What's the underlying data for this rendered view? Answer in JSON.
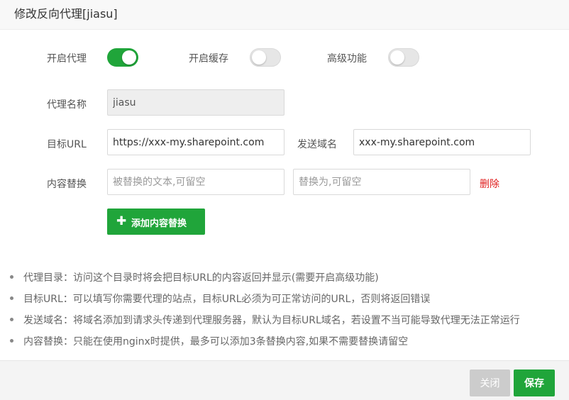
{
  "dialog": {
    "title": "修改反向代理[jiasu]"
  },
  "toggles": [
    {
      "label": "开启代理",
      "state": "on"
    },
    {
      "label": "开启缓存",
      "state": "off"
    },
    {
      "label": "高级功能",
      "state": "off"
    }
  ],
  "form": {
    "proxy_name": {
      "label": "代理名称",
      "value": "jiasu"
    },
    "target_url": {
      "label": "目标URL",
      "value": "https://xxx-my.sharepoint.com"
    },
    "send_domain": {
      "label": "发送域名",
      "value": "xxx-my.sharepoint.com"
    },
    "content_replace": {
      "label": "内容替换",
      "source_placeholder": "被替换的文本,可留空",
      "target_placeholder": "替换为,可留空",
      "delete_label": "删除"
    },
    "add_button": {
      "icon": "plus-icon",
      "label": "添加内容替换"
    }
  },
  "tips": [
    "代理目录：访问这个目录时将会把目标URL的内容返回并显示(需要开启高级功能)",
    "目标URL：可以填写你需要代理的站点，目标URL必须为可正常访问的URL，否则将返回错误",
    "发送域名：将域名添加到请求头传递到代理服务器，默认为目标URL域名，若设置不当可能导致代理无法正常运行",
    "内容替换：只能在使用nginx时提供，最多可以添加3条替换内容,如果不需要替换请留空"
  ],
  "footer": {
    "close_label": "关闭",
    "save_label": "保存"
  },
  "colors": {
    "accent": "#20a53a",
    "danger": "#e02020",
    "disabled": "#cccccc"
  }
}
